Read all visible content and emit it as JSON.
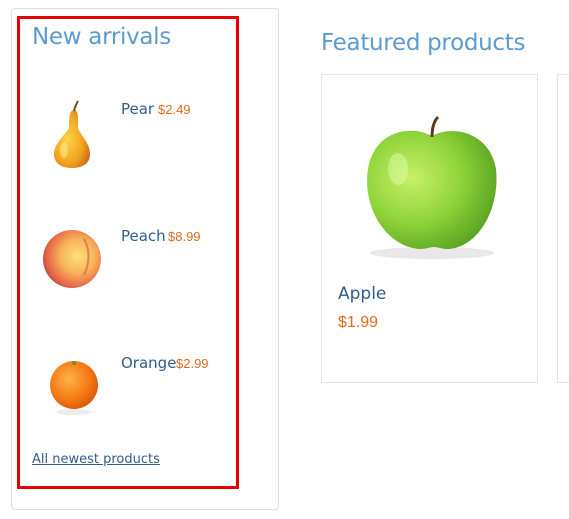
{
  "new_arrivals": {
    "title": "New arrivals",
    "items": [
      {
        "name": "Pear",
        "price": "$2.49"
      },
      {
        "name": "Peach",
        "price": "$8.99"
      },
      {
        "name": "Orange",
        "price": "$2.99"
      }
    ],
    "all_link": "All newest products"
  },
  "featured": {
    "title": "Featured products",
    "products": [
      {
        "name": "Apple",
        "price": "$1.99"
      }
    ]
  },
  "colors": {
    "heading": "#5b9bd0",
    "link": "#2f5d8a",
    "price": "#e06a1c",
    "highlight_border": "#e60000"
  },
  "icons": [
    "pear-image",
    "peach-image",
    "orange-image",
    "apple-image"
  ]
}
